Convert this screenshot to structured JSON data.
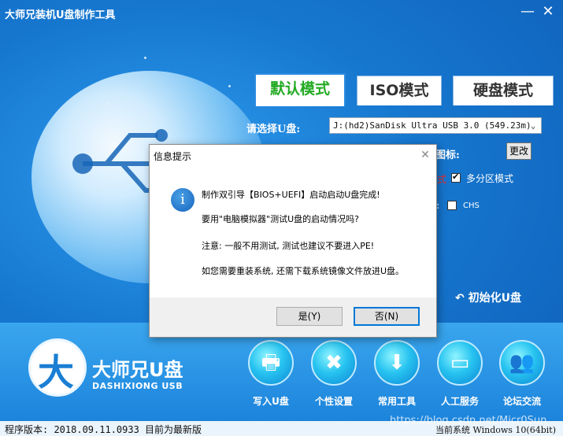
{
  "window": {
    "title": "大师兄装机U盘制作工具",
    "minimize": "—",
    "close": "✕"
  },
  "tabs": [
    {
      "label": "默认模式",
      "active": true
    },
    {
      "label": "ISO模式",
      "active": false
    },
    {
      "label": "硬盘模式",
      "active": false
    }
  ],
  "settings": {
    "select_usb_label": "请选择U盘:",
    "usb_device": "J:(hd2)SanDisk Ultra USB 3.0 (549.23m)",
    "icon_label": "图标:",
    "change_button": "更改",
    "partial_mode_text": "式",
    "multi_partition_label": "多分区模式",
    "multi_partition_checked": true,
    "colon_text": ":",
    "chs_label": "CHS",
    "chs_checked": false,
    "init_usb": "初始化U盘"
  },
  "brand": {
    "logo_glyph": "大",
    "name_cn": "大师兄U盘",
    "name_en": "DASHIXIONG USB"
  },
  "toolbar": [
    {
      "label": "写入U盘",
      "icon": "printer-icon",
      "glyph": "🖶"
    },
    {
      "label": "个性设置",
      "icon": "tools-icon",
      "glyph": "✖"
    },
    {
      "label": "常用工具",
      "icon": "download-icon",
      "glyph": "⬇"
    },
    {
      "label": "人工服务",
      "icon": "folder-icon",
      "glyph": "▭"
    },
    {
      "label": "论坛交流",
      "icon": "users-icon",
      "glyph": "👥"
    }
  ],
  "status": {
    "version": "程序版本: 2018.09.11.0933 目前为最新版",
    "system": "当前系统 Windows 10(64bit)",
    "watermark": "https://blog.csdn.net/Micr0Sun"
  },
  "dialog": {
    "title": "信息提示",
    "close": "✕",
    "icon_glyph": "i",
    "messages": [
      "制作双引导【BIOS+UEFI】启动启动U盘完成!",
      "要用\"电脑模拟器\"测试U盘的启动情况吗?",
      "注意: 一般不用测试, 测试也建议不要进入PE!",
      "如您需要重装系统, 还需下载系统镜像文件放进U盘。"
    ],
    "yes_button": "是(Y)",
    "no_button": "否(N)"
  },
  "colors": {
    "accent_blue": "#1a7fd4",
    "active_tab_text": "#22aa22",
    "dialog_default_border": "#0078d7"
  }
}
